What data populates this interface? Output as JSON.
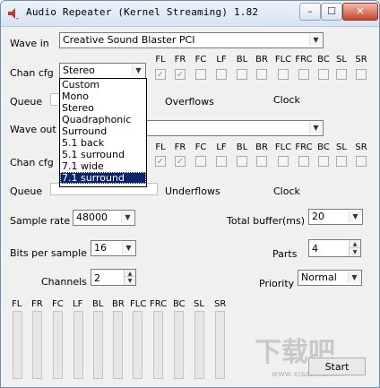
{
  "window": {
    "title": "Audio Repeater (Kernel Streaming) 1.82",
    "min_glyph": "–",
    "max_glyph": "☐",
    "close_glyph": "✕"
  },
  "wave_in": {
    "label": "Wave in",
    "value": "Creative Sound Blaster PCI"
  },
  "chan_cfg_1": {
    "label": "Chan cfg",
    "value": "Stereo"
  },
  "channels_header": [
    "FL",
    "FR",
    "FC",
    "LF",
    "BL",
    "BR",
    "FLC",
    "FRC",
    "BC",
    "SL",
    "SR"
  ],
  "queue_1": {
    "label": "Queue",
    "overflows": "Overflows",
    "clock": "Clock"
  },
  "wave_out": {
    "label": "Wave out",
    "value": ""
  },
  "chan_cfg_2": {
    "label": "Chan cfg"
  },
  "queue_2": {
    "label": "Queue",
    "underflows": "Underflows",
    "clock": "Clock"
  },
  "dropdown": {
    "options": [
      "Custom",
      "Mono",
      "Stereo",
      "Quadraphonic",
      "Surround",
      "5.1 back",
      "5.1 surround",
      "7.1 wide",
      "7.1 surround"
    ],
    "selected": "7.1 surround"
  },
  "sample_rate": {
    "label": "Sample rate",
    "value": "48000"
  },
  "total_buffer": {
    "label": "Total buffer(ms)",
    "value": "20"
  },
  "bits_per_sample": {
    "label": "Bits per sample",
    "value": "16"
  },
  "parts": {
    "label": "Parts",
    "value": "4"
  },
  "channels": {
    "label": "Channels",
    "value": "2"
  },
  "priority": {
    "label": "Priority",
    "value": "Normal"
  },
  "vu_labels": [
    "FL",
    "FR",
    "FC",
    "LF",
    "BL",
    "BR",
    "FLC",
    "FRC",
    "BC",
    "SL",
    "SR"
  ],
  "start_button": "Start",
  "watermark": {
    "main": "下载吧",
    "url": "www.xiazaiba.com"
  }
}
